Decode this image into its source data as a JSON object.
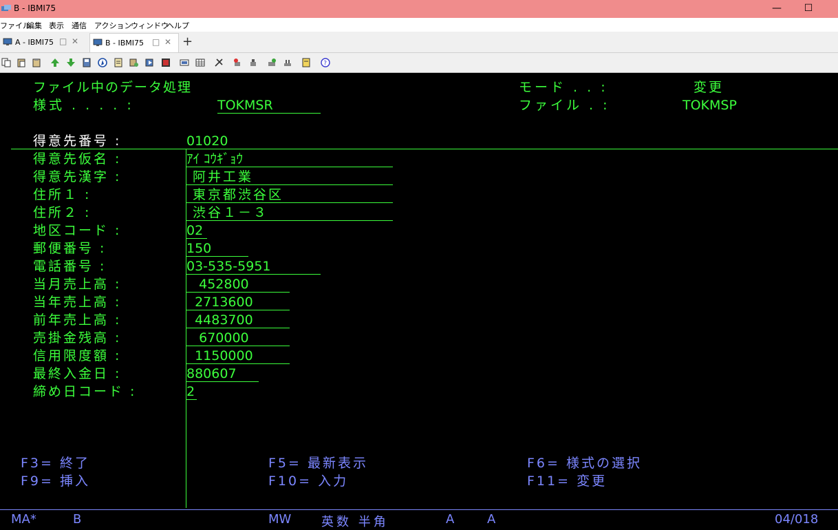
{
  "window": {
    "title": "B - IBMI75"
  },
  "menu": [
    "ファイル",
    "編集",
    "表示",
    "通信",
    "アクション",
    "ウィンドウ",
    "ヘルプ"
  ],
  "tabs": [
    {
      "label": "A - IBMI75"
    },
    {
      "label": "B - IBMI75"
    }
  ],
  "screen": {
    "heading": "ファイル中のデータ処理",
    "format_label": "様式 . . . . :",
    "format_value": "TOKMSR",
    "mode_label": "モード . . :",
    "mode_value": "変更",
    "file_label": "ファイル . :",
    "file_value": "TOKMSP",
    "fields": [
      {
        "label": "得意先番号 :",
        "value": "01020"
      },
      {
        "label": "得意先仮名 :",
        "value": "ｱｲ ｺｳｷﾞｮｳ"
      },
      {
        "label": "得意先漢字 :",
        "value": " 阿井工業"
      },
      {
        "label": "住所１ :",
        "value": " 東京都渋谷区"
      },
      {
        "label": "住所２ :",
        "value": " 渋谷１－３"
      },
      {
        "label": "地区コード :",
        "value": "02"
      },
      {
        "label": "郵便番号 :",
        "value": "150"
      },
      {
        "label": "電話番号 :",
        "value": "03-535-5951"
      },
      {
        "label": "当月売上高 :",
        "value": "   452800"
      },
      {
        "label": "当年売上高 :",
        "value": "  2713600"
      },
      {
        "label": "前年売上高 :",
        "value": "  4483700"
      },
      {
        "label": "売掛金残高 :",
        "value": "   670000"
      },
      {
        "label": "信用限度額 :",
        "value": "  1150000"
      },
      {
        "label": "最終入金日 :",
        "value": "880607"
      },
      {
        "label": "締め日コード :",
        "value": "2"
      }
    ],
    "fkeys": {
      "f3": "F3= 終了",
      "f5": "F5= 最新表示",
      "f6": "F6= 様式の選択",
      "f9": "F9= 挿入",
      "f10": "F10= 入力",
      "f11": "F11= 変更"
    }
  },
  "status": {
    "ma": "MA*",
    "session": "B",
    "mw": "MW",
    "input_mode": "英数 半角",
    "a1": "A",
    "a2": "A",
    "cursor": "04/018"
  },
  "colors": {
    "field_green": "#3cff3c",
    "fkey_blue": "#7b86ff",
    "titlebar": "#f08c8c"
  }
}
